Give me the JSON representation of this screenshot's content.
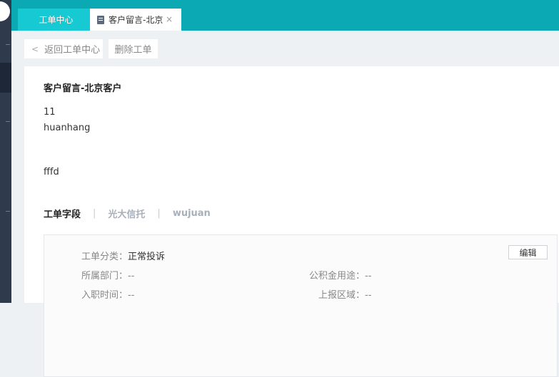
{
  "tabs": {
    "home": "工单中心",
    "active": "客户留言-北京",
    "close_glyph": "×"
  },
  "toolbar": {
    "back_chevron": "<",
    "back_label": "返回工单中心",
    "delete_label": "删除工单"
  },
  "ticket": {
    "title": "客户留言-北京客户",
    "message_lines": [
      "11",
      "huanhang",
      "fffd"
    ]
  },
  "field_tabs": [
    "工单字段",
    "光大信托",
    "wujuan"
  ],
  "field_tab_separator": "|",
  "fields": {
    "edit_label": "编辑",
    "category": {
      "label": "工单分类：",
      "value": "正常投诉"
    },
    "department": {
      "label": "所属部门：",
      "value": "--"
    },
    "fund_use": {
      "label": "公积金用途：",
      "value": "--"
    },
    "hire_date": {
      "label": "入职时间：",
      "value": "--"
    },
    "report_area": {
      "label": "上报区域：",
      "value": "--"
    }
  },
  "colors": {
    "topbar": "#0aa9b4",
    "home_tab": "#16c9d3",
    "sidebar": "#2f3a4d"
  }
}
